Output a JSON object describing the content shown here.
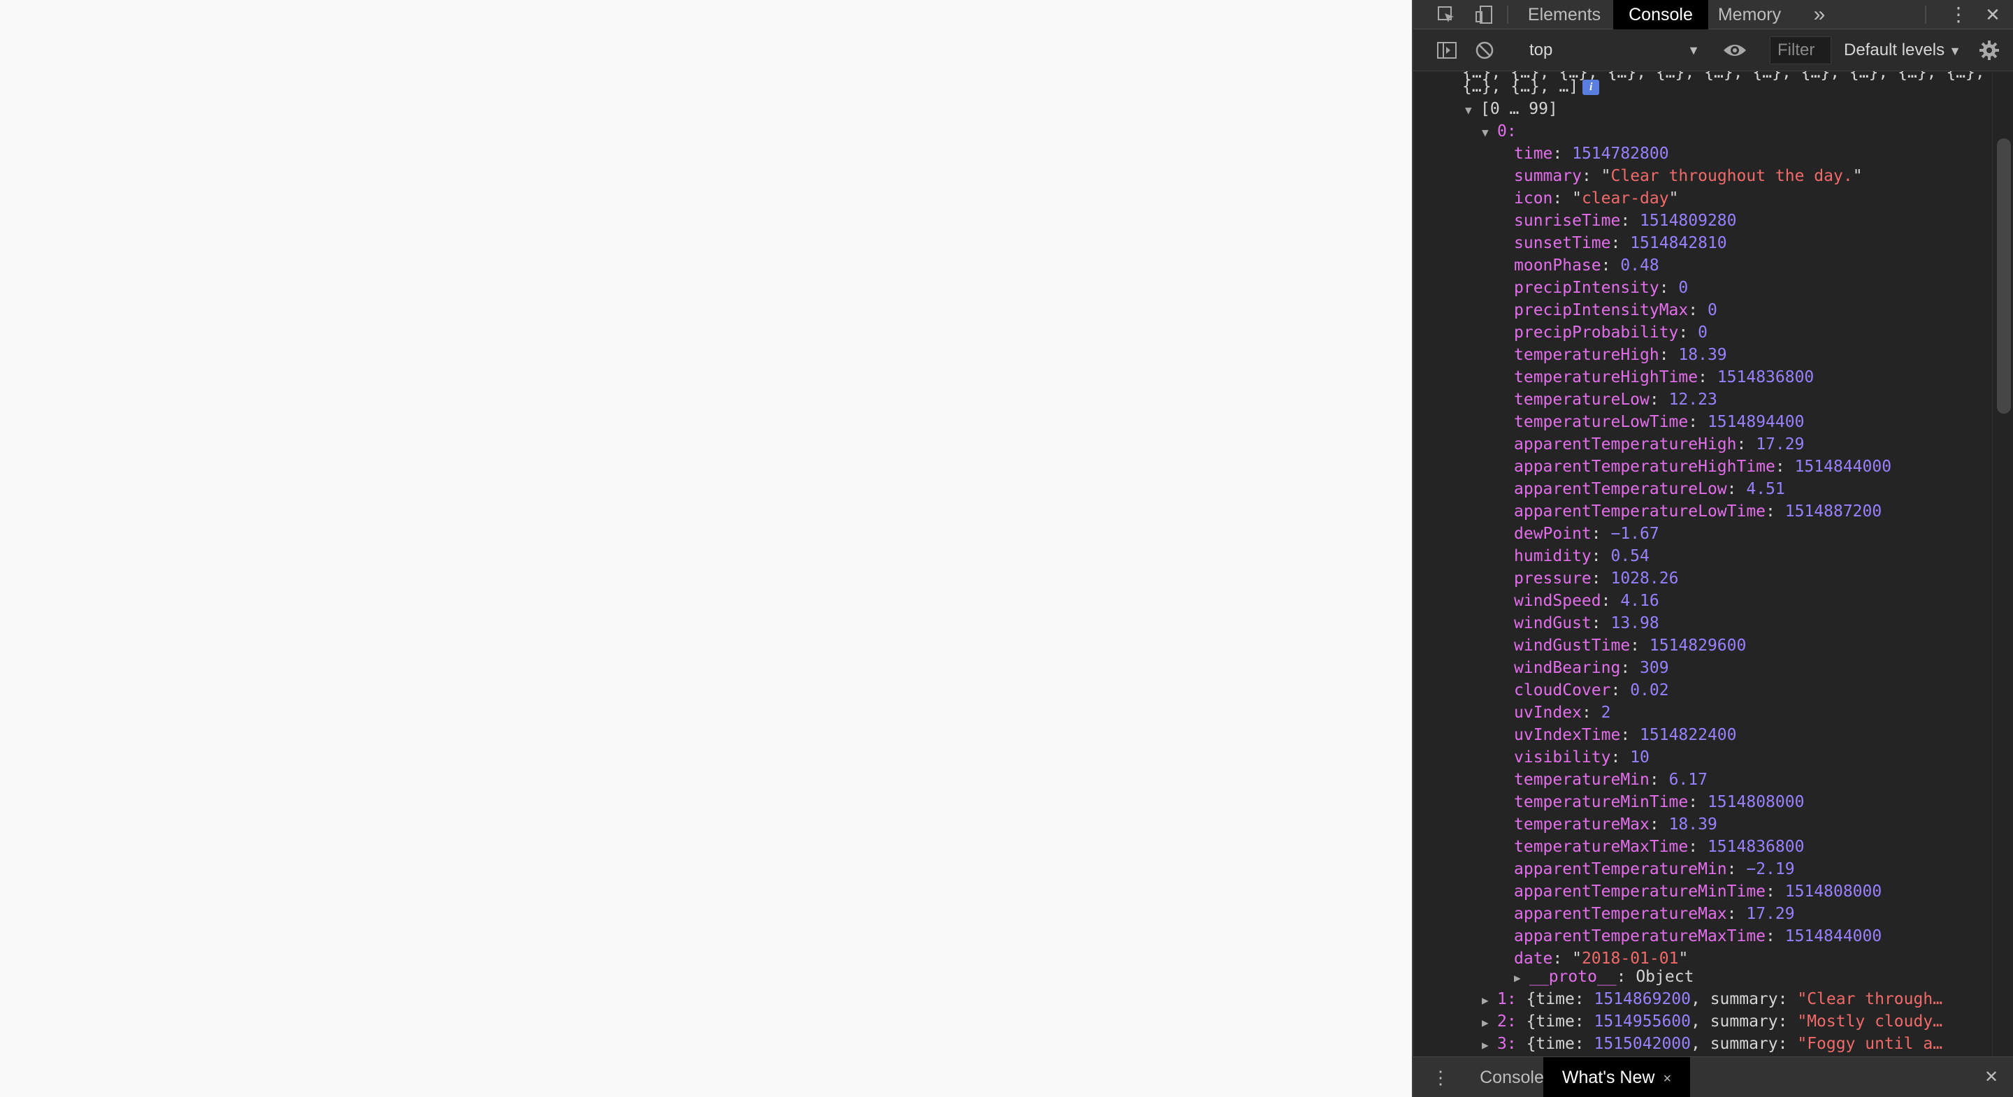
{
  "devtools": {
    "tabs": [
      "Elements",
      "Console",
      "Memory"
    ],
    "active_tab": "Console",
    "more_tabs_glyph": "»",
    "kebab_glyph": "⋮",
    "close_glyph": "✕"
  },
  "toolbar": {
    "context": "top",
    "filter_placeholder": "Filter",
    "levels_label": "Default levels",
    "caret_glyph": "▼"
  },
  "console": {
    "preview_line_1": "{…}, {…}, {…}, {…}, {…}, {…}, {…}, {…}, {…}, {…}, {…},",
    "preview_line_2": "{…}, {…}, …]",
    "info_badge": "i",
    "range_label": "[0 … 99]",
    "expanded_index": "0:",
    "properties": [
      {
        "key": "time",
        "value": "1514782800",
        "type": "num"
      },
      {
        "key": "summary",
        "value": "Clear throughout the day.",
        "type": "str"
      },
      {
        "key": "icon",
        "value": "clear-day",
        "type": "str"
      },
      {
        "key": "sunriseTime",
        "value": "1514809280",
        "type": "num"
      },
      {
        "key": "sunsetTime",
        "value": "1514842810",
        "type": "num"
      },
      {
        "key": "moonPhase",
        "value": "0.48",
        "type": "num"
      },
      {
        "key": "precipIntensity",
        "value": "0",
        "type": "num"
      },
      {
        "key": "precipIntensityMax",
        "value": "0",
        "type": "num"
      },
      {
        "key": "precipProbability",
        "value": "0",
        "type": "num"
      },
      {
        "key": "temperatureHigh",
        "value": "18.39",
        "type": "num"
      },
      {
        "key": "temperatureHighTime",
        "value": "1514836800",
        "type": "num"
      },
      {
        "key": "temperatureLow",
        "value": "12.23",
        "type": "num"
      },
      {
        "key": "temperatureLowTime",
        "value": "1514894400",
        "type": "num"
      },
      {
        "key": "apparentTemperatureHigh",
        "value": "17.29",
        "type": "num"
      },
      {
        "key": "apparentTemperatureHighTime",
        "value": "1514844000",
        "type": "num"
      },
      {
        "key": "apparentTemperatureLow",
        "value": "4.51",
        "type": "num"
      },
      {
        "key": "apparentTemperatureLowTime",
        "value": "1514887200",
        "type": "num"
      },
      {
        "key": "dewPoint",
        "value": "−1.67",
        "type": "num"
      },
      {
        "key": "humidity",
        "value": "0.54",
        "type": "num"
      },
      {
        "key": "pressure",
        "value": "1028.26",
        "type": "num"
      },
      {
        "key": "windSpeed",
        "value": "4.16",
        "type": "num"
      },
      {
        "key": "windGust",
        "value": "13.98",
        "type": "num"
      },
      {
        "key": "windGustTime",
        "value": "1514829600",
        "type": "num"
      },
      {
        "key": "windBearing",
        "value": "309",
        "type": "num"
      },
      {
        "key": "cloudCover",
        "value": "0.02",
        "type": "num"
      },
      {
        "key": "uvIndex",
        "value": "2",
        "type": "num"
      },
      {
        "key": "uvIndexTime",
        "value": "1514822400",
        "type": "num"
      },
      {
        "key": "visibility",
        "value": "10",
        "type": "num"
      },
      {
        "key": "temperatureMin",
        "value": "6.17",
        "type": "num"
      },
      {
        "key": "temperatureMinTime",
        "value": "1514808000",
        "type": "num"
      },
      {
        "key": "temperatureMax",
        "value": "18.39",
        "type": "num"
      },
      {
        "key": "temperatureMaxTime",
        "value": "1514836800",
        "type": "num"
      },
      {
        "key": "apparentTemperatureMin",
        "value": "−2.19",
        "type": "num"
      },
      {
        "key": "apparentTemperatureMinTime",
        "value": "1514808000",
        "type": "num"
      },
      {
        "key": "apparentTemperatureMax",
        "value": "17.29",
        "type": "num"
      },
      {
        "key": "apparentTemperatureMaxTime",
        "value": "1514844000",
        "type": "num"
      },
      {
        "key": "date",
        "value": "2018-01-01",
        "type": "str"
      }
    ],
    "proto": {
      "key": "__proto__",
      "value": "Object"
    },
    "collapsed_rows": [
      {
        "index": "1",
        "time": "1514869200",
        "summary": "Clear through…"
      },
      {
        "index": "2",
        "time": "1514955600",
        "summary": "Mostly cloudy…"
      },
      {
        "index": "3",
        "time": "1515042000",
        "summary": "Foggy until a…"
      }
    ]
  },
  "drawer": {
    "tabs": [
      "Console",
      "What's New"
    ],
    "active_tab": "What's New",
    "tab_close_glyph": "×",
    "close_glyph": "✕"
  }
}
